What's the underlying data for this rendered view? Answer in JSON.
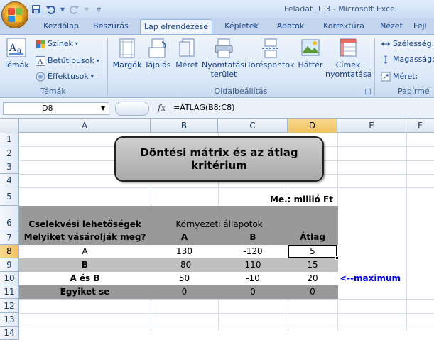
{
  "window": {
    "title": "Feladat_1_3 - Microsoft Excel"
  },
  "qat": {
    "icons": [
      "save-icon",
      "undo-icon",
      "redo-icon",
      "customize-icon"
    ]
  },
  "tabs": [
    "Kezdőlap",
    "Beszúrás",
    "Lap elrendezése",
    "Képletek",
    "Adatok",
    "Korrektúra",
    "Nézet",
    "Fejl"
  ],
  "active_tab": "Lap elrendezése",
  "ribbon": {
    "temak": {
      "label": "Témák",
      "btn": "Témák",
      "szinek": "Színek",
      "betutipusok": "Betűtípusok",
      "effektusok": "Effektusok"
    },
    "oldal": {
      "label": "Oldalbeállítás",
      "margok": "Margók",
      "tajolas": "Tájolás",
      "meret": "Méret",
      "nyomtatasi_terulet_1": "Nyomtatási",
      "nyomtatasi_terulet_2": "terület",
      "torespontok": "Töréspontok",
      "hatter": "Háttér",
      "cimek_1": "Címek",
      "cimek_2": "nyomtatása"
    },
    "papir": {
      "label": "Papírmé",
      "szelesseg": "Szélesség:",
      "magassag": "Magasság:",
      "meret": "Méret:"
    }
  },
  "formula_bar": {
    "name_box": "D8",
    "fx": "fx",
    "formula": "=ÁTLAG(B8:C8)"
  },
  "columns": [
    "A",
    "B",
    "C",
    "D",
    "E",
    "F"
  ],
  "rows": [
    "1",
    "2",
    "3",
    "4",
    "5",
    "6",
    "7",
    "8",
    "9",
    "10",
    "11",
    "12",
    "13",
    "14"
  ],
  "sheet": {
    "title_line1": "Döntési mátrix és az átlag",
    "title_line2": "kritérium",
    "unit": "Me.: millió Ft",
    "h6_a": "Cselekvési lehetőségek",
    "h6_bc": "Környezeti állapotok",
    "h7_a": "Melyiket vásárolják meg?",
    "h7_b": "A",
    "h7_c": "B",
    "h7_d": "Átlag",
    "data": [
      {
        "label": "A",
        "b": "130",
        "c": "-120",
        "d": "5"
      },
      {
        "label": "B",
        "b": "-80",
        "c": "110",
        "d": "15"
      },
      {
        "label": "A és B",
        "b": "50",
        "c": "-10",
        "d": "20"
      },
      {
        "label": "Egyiket se",
        "b": "0",
        "c": "0",
        "d": "0"
      }
    ],
    "annotation": "<--maximum"
  },
  "colors": {
    "band_dark": "#999999",
    "band_mid": "#c0c0c0",
    "annotation": "#0000ff"
  }
}
